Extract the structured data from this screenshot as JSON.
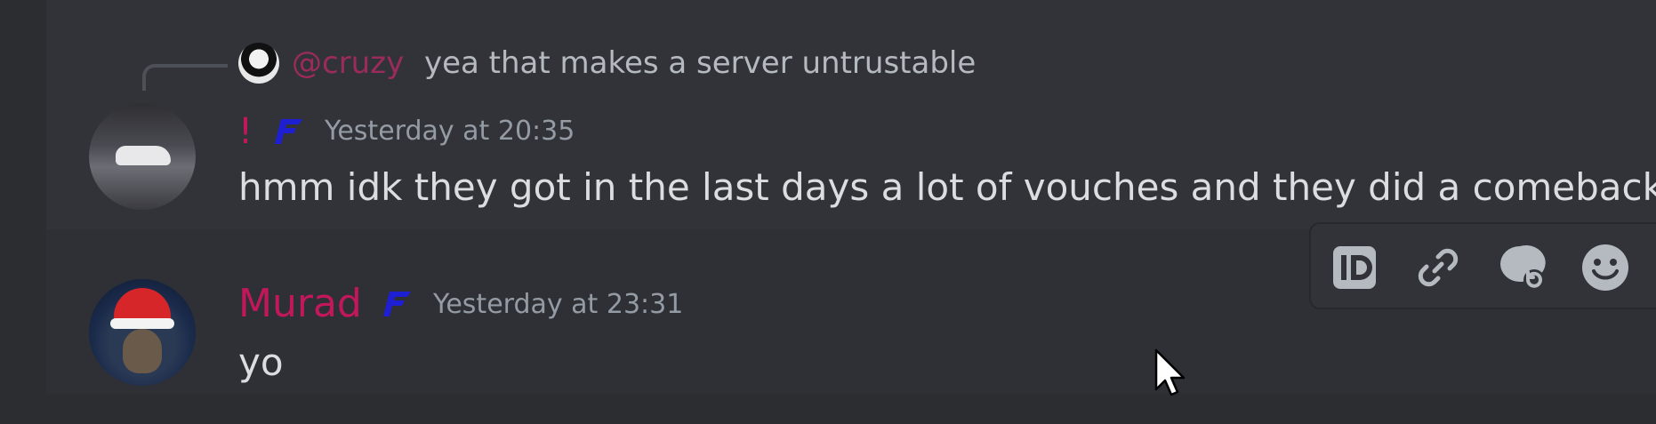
{
  "reply": {
    "mention": "@cruzy",
    "text": "yea that makes a server untrustable"
  },
  "messages": [
    {
      "username": "!",
      "timestamp": "Yesterday at 20:35",
      "text": "hmm idk they got in the last days a lot of vouches and they did a comeback too",
      "avatar_icon": "car-photo-avatar"
    },
    {
      "username": "Murad",
      "timestamp": "Yesterday at 23:31",
      "text": "yo",
      "avatar_icon": "santa-hat-avatar"
    }
  ],
  "colors": {
    "background": "#313338",
    "username": "#c2185b",
    "mention": "#9b2b5a",
    "timestamp": "#949ba4",
    "message_text": "#dbdee1",
    "role_icon": "#1e1ed2"
  },
  "toolbar": {
    "icons": [
      "id-icon",
      "link-icon",
      "thread-icon",
      "emoji-icon"
    ]
  }
}
